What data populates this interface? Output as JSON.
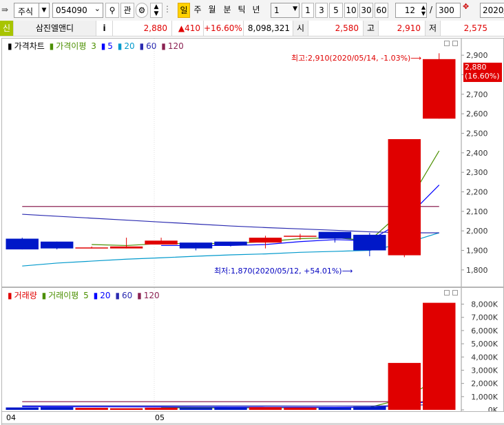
{
  "toolbar": {
    "market_select": "주식",
    "stock_code": "054090",
    "btn_watch": "관",
    "btn_period_active": "일",
    "btn_week": "주",
    "btn_month": "월",
    "btn_minute": "분",
    "btn_tick": "틱",
    "btn_year": "년",
    "interval_value": "1",
    "quick_buttons": [
      "1",
      "3",
      "5",
      "10",
      "30",
      "60"
    ],
    "count_value": "12",
    "slash": "/",
    "total_value": "300",
    "date_value": "2020/"
  },
  "quote": {
    "badge": "신",
    "name": "삼진엘앤디",
    "info": "i",
    "price": "2,880",
    "change": "▲410",
    "rate": "+16.60%",
    "volume": "8,098,321",
    "open_label": "시",
    "open": "2,580",
    "high_label": "고",
    "high": "2,910",
    "low_label": "저",
    "low": "2,575"
  },
  "price_panel": {
    "legend": {
      "main": "가격차트",
      "ma_label": "가격이평",
      "ma_values": [
        "3",
        "5",
        "20",
        "60",
        "120"
      ]
    },
    "axis_ticks": [
      "2,900",
      "2,800",
      "2,700",
      "2,600",
      "2,500",
      "2,400",
      "2,300",
      "2,200",
      "2,100",
      "2,000",
      "1,900",
      "1,800"
    ],
    "current_tag": "2,880",
    "current_rate_tag": "(16.60%)",
    "annotation_high": "최고:2,910(2020/05/14, -1.03%)⟶",
    "annotation_low": "최저:1,870(2020/05/12, +54.01%)⟶"
  },
  "volume_panel": {
    "legend": {
      "main": "거래량",
      "ma_label": "거래이평",
      "ma_values": [
        "5",
        "20",
        "60",
        "120"
      ]
    },
    "axis_ticks": [
      "8,000K",
      "7,000K",
      "6,000K",
      "5,000K",
      "4,000K",
      "3,000K",
      "2,000K",
      "1,000K",
      "0K"
    ]
  },
  "x_labels": [
    "04",
    "05"
  ],
  "chart_data": [
    {
      "type": "candlestick",
      "title": "가격차트",
      "ylim": [
        1750,
        2950
      ],
      "candles": [
        {
          "o": 1960,
          "h": 1965,
          "l": 1905,
          "c": 1905
        },
        {
          "o": 1945,
          "h": 1945,
          "l": 1905,
          "c": 1910
        },
        {
          "o": 1915,
          "h": 1920,
          "l": 1910,
          "c": 1915
        },
        {
          "o": 1910,
          "h": 1965,
          "l": 1910,
          "c": 1920
        },
        {
          "o": 1930,
          "h": 1965,
          "l": 1930,
          "c": 1950
        },
        {
          "o": 1940,
          "h": 1940,
          "l": 1900,
          "c": 1910
        },
        {
          "o": 1945,
          "h": 1945,
          "l": 1920,
          "c": 1925
        },
        {
          "o": 1940,
          "h": 1975,
          "l": 1910,
          "c": 1965
        },
        {
          "o": 1975,
          "h": 1985,
          "l": 1955,
          "c": 1975
        },
        {
          "o": 1995,
          "h": 1995,
          "l": 1940,
          "c": 1960
        },
        {
          "o": 1980,
          "h": 1990,
          "l": 1870,
          "c": 1900
        },
        {
          "o": 1875,
          "h": 2470,
          "l": 1865,
          "c": 2470
        },
        {
          "o": 2575,
          "h": 2910,
          "l": 2575,
          "c": 2880
        }
      ],
      "ma": [
        {
          "name": "3",
          "color": "#4b8f00",
          "values": [
            null,
            null,
            1930,
            1925,
            1935,
            1935,
            1935,
            1945,
            1960,
            1965,
            1950,
            2110,
            2410
          ]
        },
        {
          "name": "5",
          "color": "#0000ff",
          "values": [
            null,
            null,
            null,
            null,
            1925,
            1925,
            1925,
            1930,
            1945,
            1955,
            1950,
            2055,
            2235
          ]
        },
        {
          "name": "20",
          "color": "#0099cc",
          "values": [
            1820,
            1835,
            1845,
            1855,
            1862,
            1870,
            1877,
            1882,
            1890,
            1895,
            1900,
            1935,
            1990
          ]
        },
        {
          "name": "60",
          "color": "#2a2ab0",
          "values": [
            2085,
            2075,
            2065,
            2055,
            2045,
            2035,
            2025,
            2017,
            2010,
            2003,
            1995,
            1990,
            1990
          ]
        },
        {
          "name": "120",
          "color": "#8b2252",
          "values": [
            2125,
            2125,
            2125,
            2125,
            2125,
            2125,
            2125,
            2125,
            2125,
            2125,
            2125,
            2125,
            2125
          ]
        }
      ]
    },
    {
      "type": "bar",
      "title": "거래량",
      "ylim": [
        0,
        8600
      ],
      "unit": "K",
      "values": [
        180,
        200,
        150,
        120,
        160,
        140,
        180,
        200,
        170,
        150,
        240,
        3550,
        8100
      ],
      "ma": [
        {
          "name": "5",
          "color": "#4b8f00",
          "values": [
            null,
            null,
            null,
            null,
            160,
            155,
            150,
            160,
            170,
            170,
            190,
            860,
            2400
          ]
        },
        {
          "name": "20",
          "color": "#0000ff",
          "values": [
            240,
            235,
            230,
            225,
            220,
            210,
            205,
            200,
            195,
            190,
            185,
            350,
            760
          ]
        },
        {
          "name": "60",
          "color": "#2a2ab0",
          "values": [
            310,
            310,
            305,
            300,
            300,
            300,
            295,
            295,
            290,
            290,
            285,
            320,
            420
          ]
        },
        {
          "name": "120",
          "color": "#8b2252",
          "values": [
            620,
            620,
            620,
            620,
            620,
            620,
            620,
            620,
            620,
            620,
            620,
            620,
            620
          ]
        }
      ]
    }
  ]
}
